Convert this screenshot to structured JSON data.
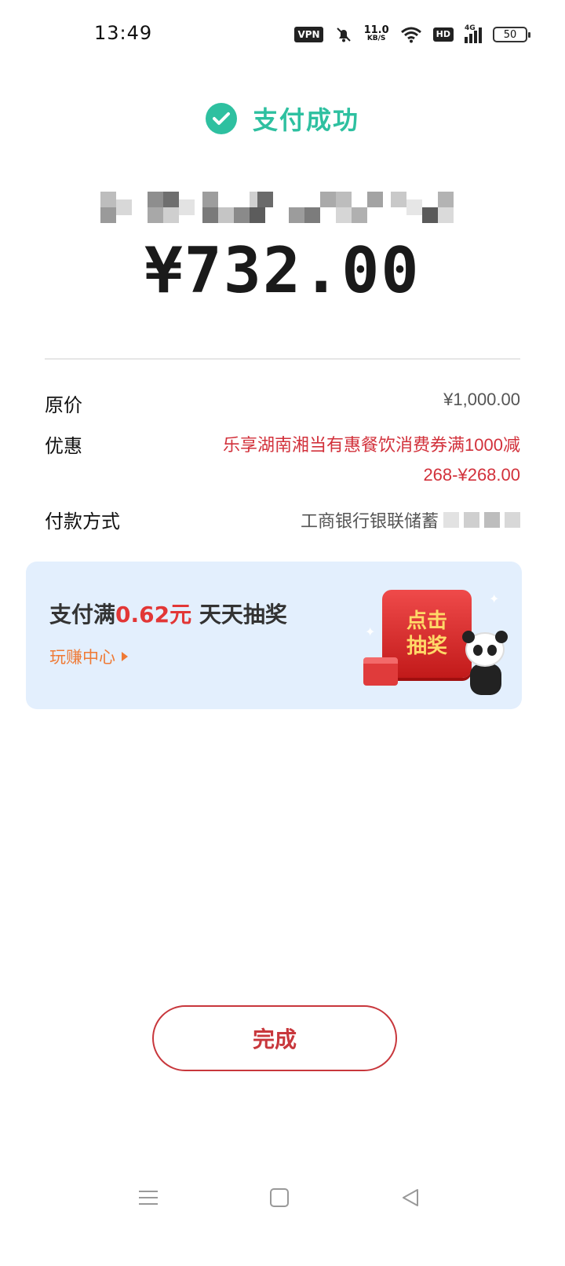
{
  "status_bar": {
    "time": "13:49",
    "vpn": "VPN",
    "speed_value": "11.0",
    "speed_unit": "KB/S",
    "hd": "HD",
    "network": "4G",
    "battery": "50"
  },
  "header": {
    "title": "支付成功",
    "icon": "check-circle-icon",
    "accent_color": "#2ec0a0"
  },
  "payment": {
    "amount": "¥732.00"
  },
  "details": {
    "original_label": "原价",
    "original_value": "¥1,000.00",
    "discount_label": "优惠",
    "discount_value": "乐享湖南湘当有惠餐饮消费券满1000减268-¥268.00",
    "method_label": "付款方式",
    "method_value": "工商银行银联储蓄"
  },
  "banner": {
    "title_prefix": "支付满",
    "title_amount": "0.62元",
    "title_suffix": " 天天抽奖",
    "link": "玩赚中心",
    "draw_line1": "点击",
    "draw_line2": "抽奖"
  },
  "actions": {
    "finish": "完成"
  },
  "nav": {
    "menu_icon": "menu-icon",
    "home_icon": "home-square-icon",
    "back_icon": "back-triangle-icon"
  }
}
